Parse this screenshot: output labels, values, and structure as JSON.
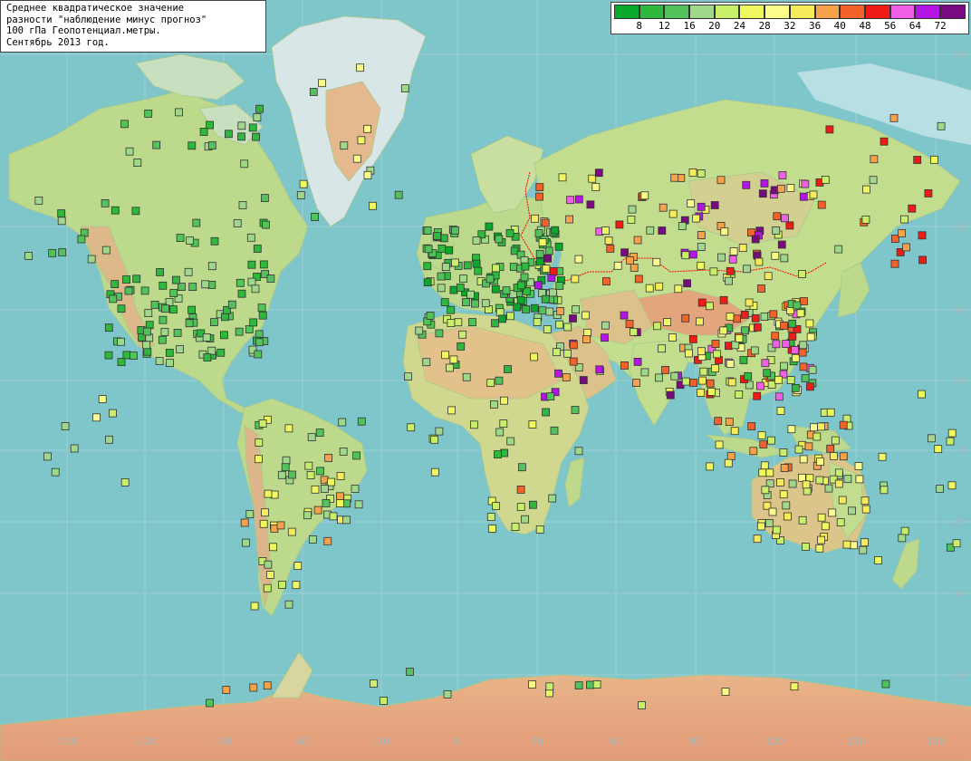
{
  "title": {
    "line1": "Среднее квадратическое значение",
    "line2": "разности \"наблюдение минус прогноз\"",
    "line3": "100 гПа Геопотенциал.метры.",
    "line4": "Сентябрь 2013 год."
  },
  "legend": {
    "colors": [
      "#0aa82a",
      "#2eb83e",
      "#52c35a",
      "#9fd88a",
      "#c9ee6a",
      "#f0f860",
      "#fbfd8a",
      "#f6ec5a",
      "#f5a24a",
      "#f3622a",
      "#ee1c14",
      "#f060e6",
      "#b414e6",
      "#7a0a80"
    ],
    "labels": [
      "8",
      "12",
      "16",
      "20",
      "24",
      "28",
      "32",
      "36",
      "40",
      "48",
      "56",
      "64",
      "72"
    ]
  },
  "axes": {
    "lon_labels": [
      "-150",
      "-120",
      "-90",
      "-60",
      "-30",
      "0",
      "30",
      "60",
      "90",
      "120",
      "150",
      "180"
    ],
    "lat_labels": [
      "80",
      "60",
      "40",
      "20",
      "0",
      "-20",
      "-40",
      "-60"
    ]
  },
  "colors": {
    "ocean": "#7fc6cb",
    "ice": "#b7dfe4",
    "land_low": "#b9d98a",
    "land_mid": "#dcc58a",
    "land_high": "#e2a07a",
    "border": "#ff0000"
  }
}
